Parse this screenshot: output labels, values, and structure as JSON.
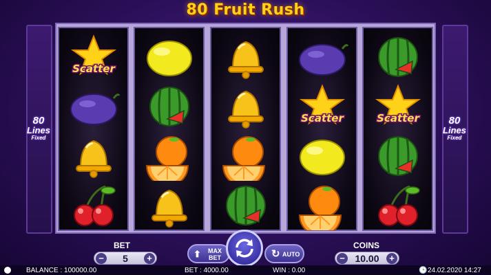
{
  "game": {
    "title": "80 Fruit Rush"
  },
  "side_panel": {
    "lines_number": "80",
    "lines_word": "Lines",
    "lines_fixed": "Fixed"
  },
  "reels": [
    [
      "scatter",
      "plum",
      "bell",
      "cherries"
    ],
    [
      "lemon",
      "watermelon",
      "orange",
      "bell"
    ],
    [
      "bell",
      "bell",
      "orange",
      "watermelon"
    ],
    [
      "plum",
      "scatter",
      "lemon",
      "orange"
    ],
    [
      "watermelon",
      "scatter",
      "watermelon",
      "cherries"
    ]
  ],
  "symbols": {
    "scatter_label": "Scatter"
  },
  "controls": {
    "bet_label": "BET",
    "bet_value": "5",
    "coins_label": "COINS",
    "coins_value": "10.00",
    "minus_label": "−",
    "plus_label": "+",
    "max_bet_line1": "MAX",
    "max_bet_line2": "BET",
    "auto_label": "AUTO"
  },
  "status_bar": {
    "balance": "BALANCE : 100000.00",
    "bet": "BET : 4000.00",
    "win": "WIN : 0.00",
    "datetime": "24.02.2020 14:27"
  },
  "colors": {
    "background": "#2a0f57",
    "title": "#ffd21a",
    "reel_frame": "#b6a6d9",
    "button": "#4b3e87"
  }
}
